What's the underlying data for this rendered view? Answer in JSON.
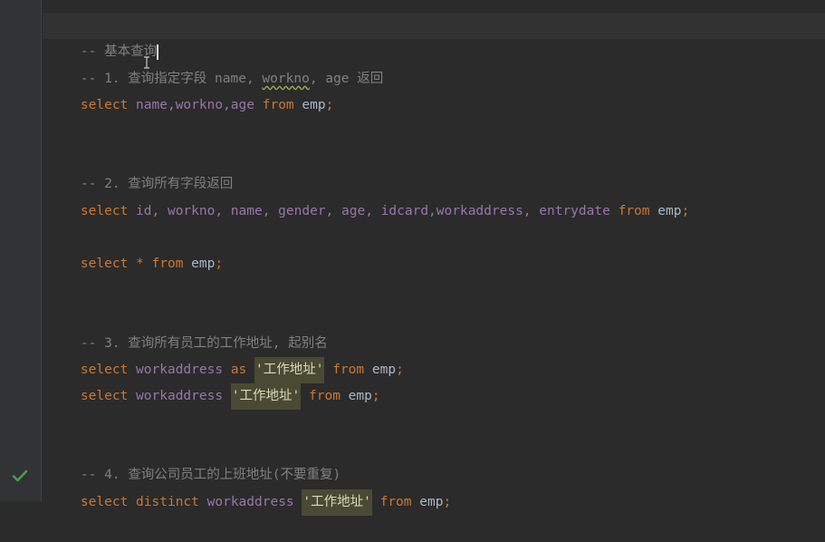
{
  "editor": {
    "lines": {
      "l1": {
        "comment": "-- 基本查询"
      },
      "l2": {
        "prefix": "-- 1. 查询指定字段 name, ",
        "squiggled": "workno",
        "suffix": ", age 返回"
      },
      "l3": {
        "select": "select",
        "cols": "name,workno,age",
        "from": "from",
        "table": "emp",
        "semi": ";"
      },
      "l4": {
        "comment": "-- 2. 查询所有字段返回"
      },
      "l5": {
        "select": "select",
        "cols": "id, workno, name, gender, age, idcard,workaddress, entrydate",
        "from": "from",
        "table": "emp",
        "semi": ";"
      },
      "l6": {
        "select": "select",
        "star": "*",
        "from": "from",
        "table": "emp",
        "semi": ";"
      },
      "l7": {
        "comment": "-- 3. 查询所有员工的工作地址, 起别名"
      },
      "l8": {
        "select": "select",
        "col": "workaddress",
        "as": "as",
        "alias": "'工作地址'",
        "from": "from",
        "table": "emp",
        "semi": ";"
      },
      "l9": {
        "select": "select",
        "col": "workaddress",
        "alias": "'工作地址'",
        "from": "from",
        "table": "emp",
        "semi": ";"
      },
      "l10": {
        "comment": "-- 4. 查询公司员工的上班地址(不要重复)"
      },
      "l11": {
        "select": "select",
        "distinct": "distinct",
        "col": "workaddress",
        "alias": "'工作地址'",
        "from": "from",
        "table": "emp",
        "semi": ";"
      }
    }
  },
  "icons": {
    "gutter_status": "checkmark-icon",
    "cursor": "ibeam-cursor-icon"
  },
  "colors": {
    "background": "#2b2b2b",
    "keyword": "#cc7832",
    "column": "#9876aa",
    "comment": "#808080",
    "check": "#4e9a4e"
  }
}
